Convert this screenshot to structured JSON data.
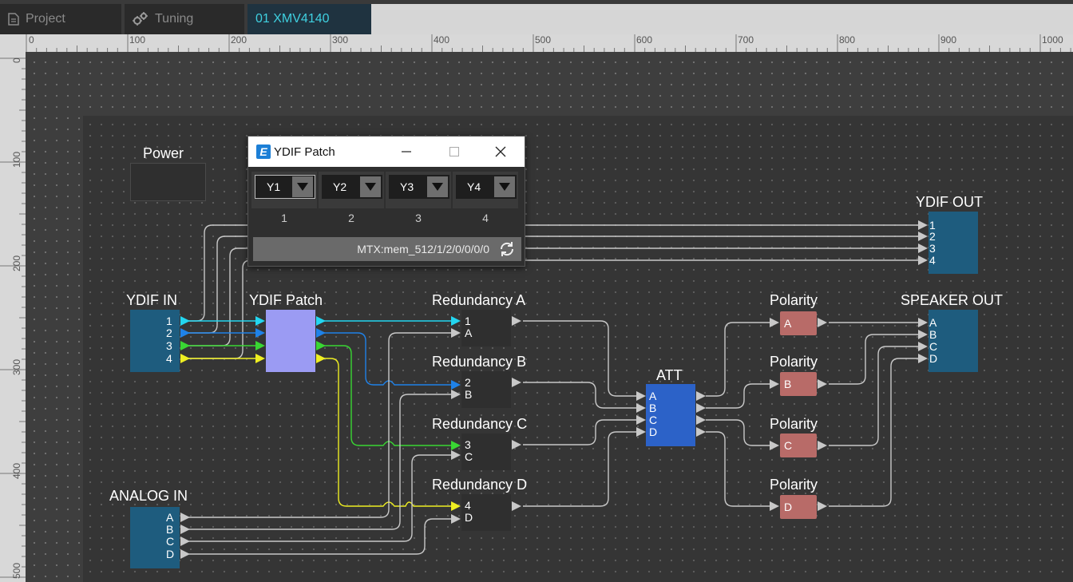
{
  "tabs": [
    {
      "label": "Project",
      "icon": "document-icon"
    },
    {
      "label": "Tuning",
      "icon": "gears-icon"
    },
    {
      "label": "01 XMV4140",
      "active": true
    }
  ],
  "ruler": {
    "top": [
      "0",
      "100",
      "200",
      "300",
      "400",
      "500",
      "600",
      "700",
      "800",
      "900",
      "1000"
    ],
    "left": [
      "0",
      "100",
      "200",
      "300",
      "400",
      "500"
    ]
  },
  "blocks": {
    "power": {
      "label": "Power"
    },
    "ydif_in": {
      "label": "YDIF IN",
      "ports": [
        "1",
        "2",
        "3",
        "4"
      ]
    },
    "ydif_patch": {
      "label": "YDIF Patch"
    },
    "analog_in": {
      "label": "ANALOG IN",
      "ports": [
        "A",
        "B",
        "C",
        "D"
      ]
    },
    "redundancy": [
      {
        "label": "Redundancy A",
        "ports": [
          "1",
          "A"
        ]
      },
      {
        "label": "Redundancy B",
        "ports": [
          "2",
          "B"
        ]
      },
      {
        "label": "Redundancy C",
        "ports": [
          "3",
          "C"
        ]
      },
      {
        "label": "Redundancy D",
        "ports": [
          "4",
          "D"
        ]
      }
    ],
    "att": {
      "label": "ATT",
      "ports": [
        "A",
        "B",
        "C",
        "D"
      ]
    },
    "polarity": [
      {
        "label": "Polarity",
        "port": "A"
      },
      {
        "label": "Polarity",
        "port": "B"
      },
      {
        "label": "Polarity",
        "port": "C"
      },
      {
        "label": "Polarity",
        "port": "D"
      }
    ],
    "ydif_out": {
      "label": "YDIF OUT",
      "ports": [
        "1",
        "2",
        "3",
        "4"
      ]
    },
    "speaker_out": {
      "label": "SPEAKER OUT",
      "ports": [
        "A",
        "B",
        "C",
        "D"
      ]
    }
  },
  "patch_window": {
    "title": "YDIF Patch",
    "slots": [
      {
        "value": "Y1",
        "number": "1"
      },
      {
        "value": "Y2",
        "number": "2"
      },
      {
        "value": "Y3",
        "number": "3"
      },
      {
        "value": "Y4",
        "number": "4"
      }
    ],
    "memory": "MTX:mem_512/1/2/0/0/0/0"
  },
  "colors": {
    "io_block": "#1e5c7e",
    "patch_block": "#9b9bf3",
    "att_block": "#2c62c8",
    "polarity_block": "#b86b68",
    "redundancy_block": "#2f2f2f",
    "wire_1": "#23d6f0",
    "wire_2": "#1f82e8",
    "wire_3": "#39d633",
    "wire_4": "#eeee22",
    "wire_default": "#c8c8c8"
  }
}
